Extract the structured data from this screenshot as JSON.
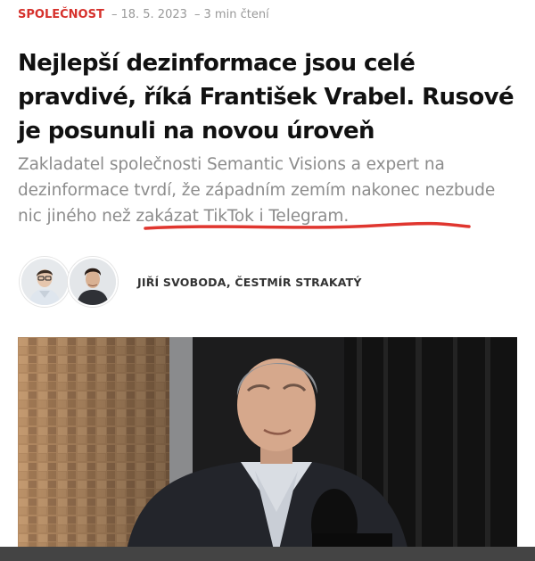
{
  "article": {
    "category": "SPOLEČNOST",
    "separator": "–",
    "date": "18. 5. 2023",
    "reading_time": "3 min čtení",
    "headline": "Nejlepší dezinformace jsou celé pravdivé, říká František Vrabel. Rusové je posunuli na novou úroveň",
    "perex": "Zakladatel společnosti Semantic Visions a expert na dezinformace tvrdí, že západním zemím nakonec nezbude nic jiného než zakázat TikTok i Telegram.",
    "authors": "JIŘÍ SVOBODA, ČESTMÍR STRAKATÝ"
  },
  "colors": {
    "category": "#d6312c",
    "headline": "#111111",
    "perex": "#8c8c8c",
    "underline_mark": "#e0362f"
  },
  "images": {
    "author_avatars": [
      "avatar-photo",
      "avatar-photo"
    ],
    "lead_photo": "interview-photo"
  }
}
